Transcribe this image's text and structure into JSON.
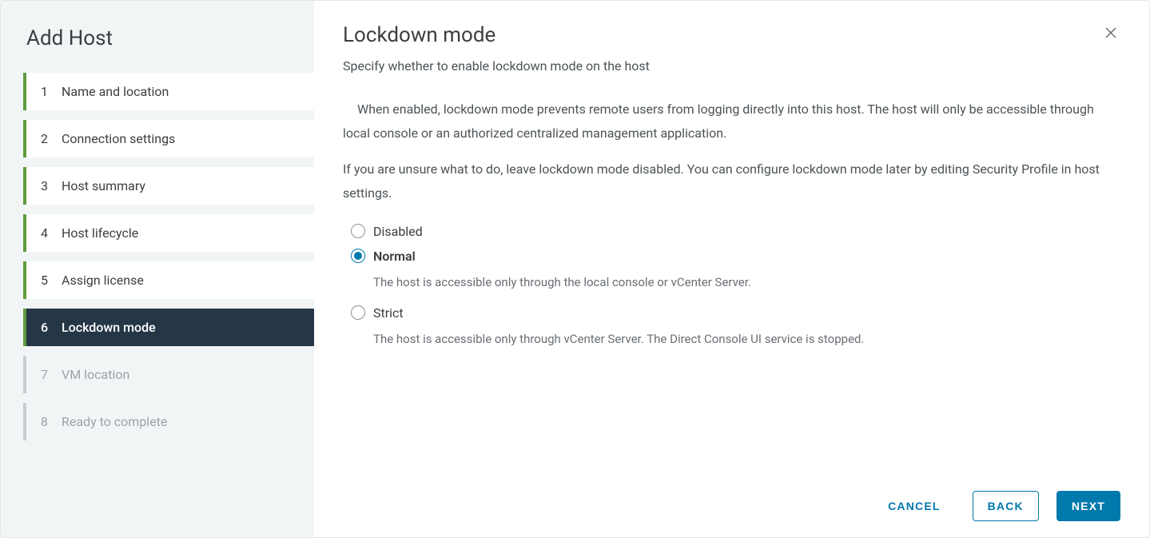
{
  "sidebar": {
    "title": "Add Host",
    "steps": [
      {
        "num": "1",
        "label": "Name and location",
        "state": "completed"
      },
      {
        "num": "2",
        "label": "Connection settings",
        "state": "completed"
      },
      {
        "num": "3",
        "label": "Host summary",
        "state": "completed"
      },
      {
        "num": "4",
        "label": "Host lifecycle",
        "state": "completed"
      },
      {
        "num": "5",
        "label": "Assign license",
        "state": "completed"
      },
      {
        "num": "6",
        "label": "Lockdown mode",
        "state": "active"
      },
      {
        "num": "7",
        "label": "VM location",
        "state": "pending"
      },
      {
        "num": "8",
        "label": "Ready to complete",
        "state": "pending"
      }
    ]
  },
  "main": {
    "title": "Lockdown mode",
    "subtitle": "Specify whether to enable lockdown mode on the host",
    "paragraph1": "When enabled, lockdown mode prevents remote users from logging directly into this host. The host will only be accessible through local console or an authorized centralized management application.",
    "paragraph2": "If you are unsure what to do, leave lockdown mode disabled. You can configure lockdown mode later by editing Security Profile in host settings.",
    "options": [
      {
        "label": "Disabled",
        "selected": false,
        "desc": ""
      },
      {
        "label": "Normal",
        "selected": true,
        "desc": "The host is accessible only through the local console or vCenter Server."
      },
      {
        "label": "Strict",
        "selected": false,
        "desc": "The host is accessible only through vCenter Server. The Direct Console UI service is stopped."
      }
    ]
  },
  "footer": {
    "cancel": "CANCEL",
    "back": "BACK",
    "next": "NEXT"
  }
}
